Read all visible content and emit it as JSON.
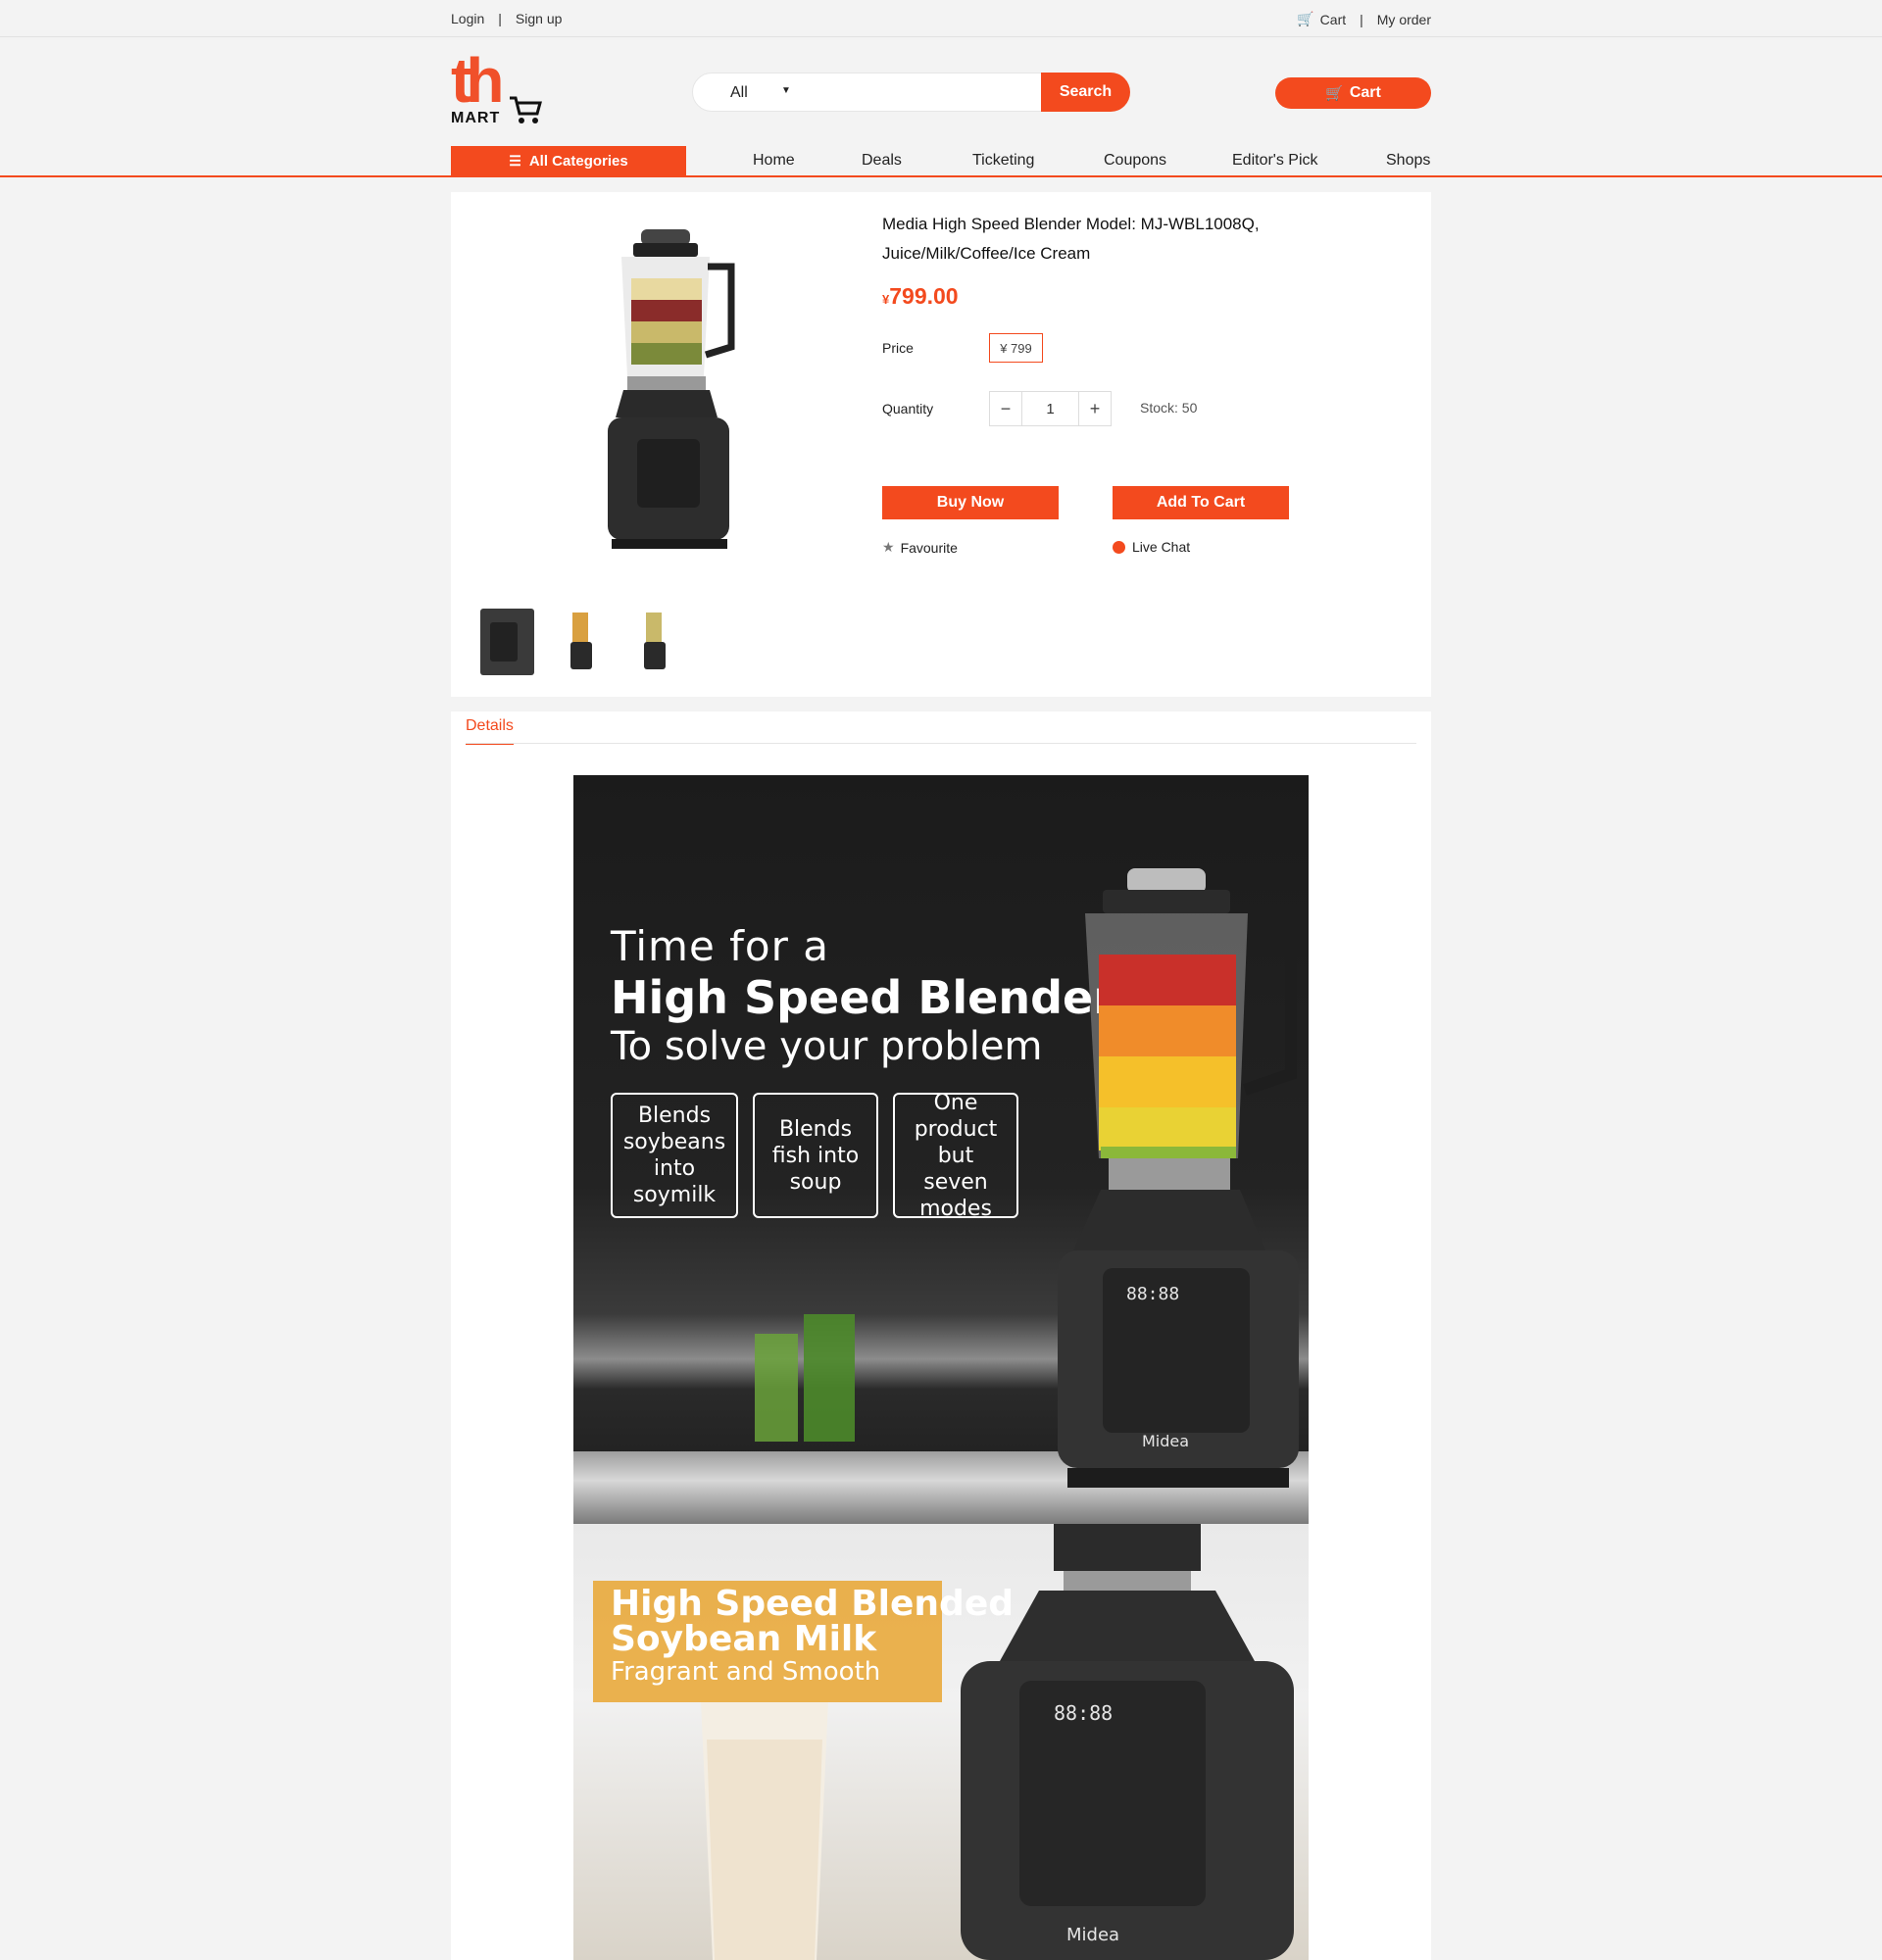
{
  "topbar": {
    "login": "Login",
    "signup": "Sign up",
    "cart": "Cart",
    "my_order": "My order"
  },
  "header": {
    "logo_top": "th",
    "logo_bottom": "MART",
    "search_scope": "All",
    "search_placeholder": "",
    "search_button": "Search",
    "cart_button": "Cart"
  },
  "nav": {
    "all_categories": "All Categories",
    "items": [
      "Home",
      "Deals",
      "Ticketing",
      "Coupons",
      "Editor's Pick",
      "Shops"
    ]
  },
  "product": {
    "title": "Media High Speed Blender Model: MJ-WBL1008Q, Juice/Milk/Coffee/Ice Cream",
    "currency_symbol": "¥",
    "price": "799.00",
    "price_label": "Price",
    "price_option": "¥ 799",
    "quantity_label": "Quantity",
    "quantity_value": "1",
    "stock": "Stock: 50",
    "buy_now": "Buy Now",
    "add_to_cart": "Add To Cart",
    "favourite": "Favourite",
    "live_chat": "Live Chat"
  },
  "details": {
    "tab": "Details",
    "banner1": {
      "line1": "Time for a",
      "line2": "High Speed Blender",
      "line3": "To solve your problem",
      "features": [
        "Blends soybeans into soymilk",
        "Blends fish into soup",
        "One product but seven modes"
      ],
      "display_text": "88:88",
      "brand": "Midea"
    },
    "banner2": {
      "line1": "High Speed Blended",
      "line2": "Soybean Milk",
      "line3": "Fragrant and Smooth",
      "display_text": "88:88",
      "brand": "Midea"
    }
  },
  "colors": {
    "accent": "#f34a1e",
    "background": "#f3f3f3",
    "banner_yellow": "#e9ad45"
  }
}
